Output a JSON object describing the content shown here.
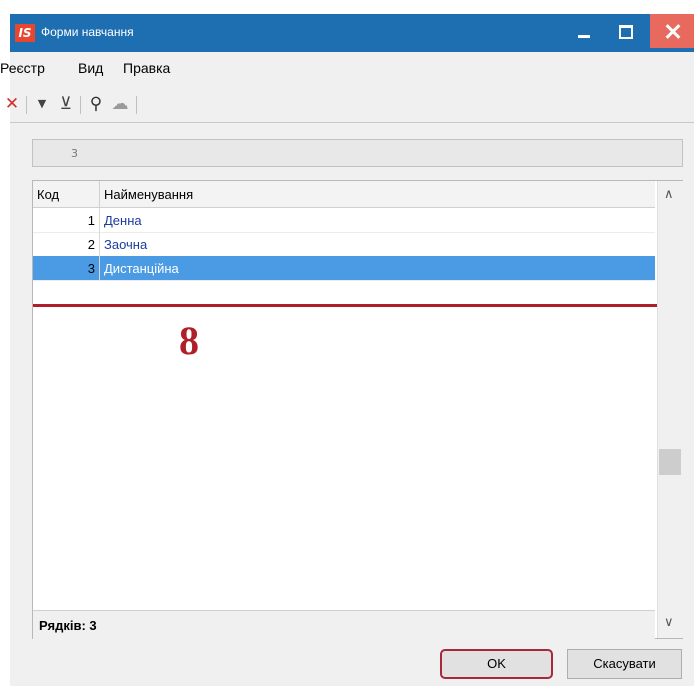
{
  "window": {
    "title": "Форми навчання",
    "logo_text": "IS"
  },
  "menu": [
    "Реєстр",
    "Вид",
    "Правка"
  ],
  "toolbar": [
    {
      "icon": "delete-icon",
      "glyph": "✕",
      "color": "#d0302a"
    },
    {
      "icon": "filter-icon",
      "glyph": "▼",
      "color": "#444444"
    },
    {
      "icon": "clear-filter-icon",
      "glyph": "⊻",
      "color": "#444444"
    },
    {
      "icon": "search-icon",
      "glyph": "⚲",
      "color": "#333333"
    },
    {
      "icon": "mouse-icon",
      "glyph": "☁",
      "color": "#9a9a9a"
    }
  ],
  "search": {
    "value": "3"
  },
  "grid": {
    "columns": [
      "Код",
      "Найменування"
    ],
    "rows": [
      {
        "code": "1",
        "name": "Денна"
      },
      {
        "code": "2",
        "name": "Заочна"
      },
      {
        "code": "3",
        "name": "Дистанційна",
        "selected": true
      }
    ],
    "footer": "Рядків: 3"
  },
  "annotation": "8",
  "buttons": {
    "ok": "OK",
    "cancel": "Скасувати"
  },
  "colors": {
    "titlebar": "#1e6fb2",
    "selection": "#4a9be4",
    "annotation": "#b01e2a"
  }
}
